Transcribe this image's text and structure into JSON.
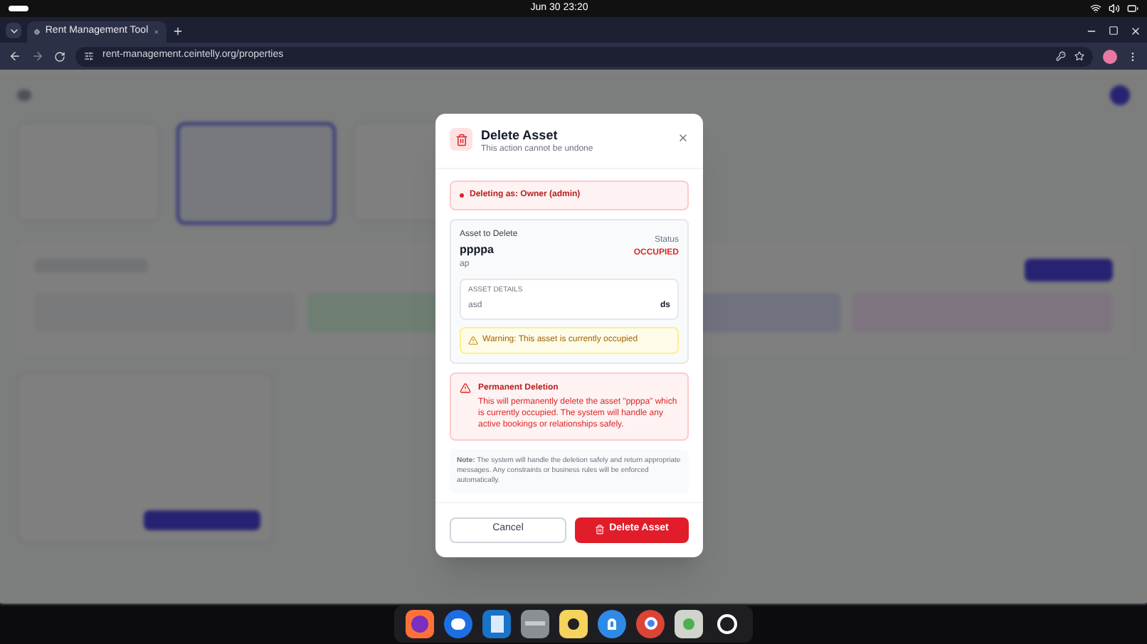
{
  "system_bar": {
    "clock": "Jun 30  23:20"
  },
  "browser": {
    "tabs": [
      {
        "title": "Rent Management Tool",
        "selected": true
      }
    ],
    "url": "rent-management.ceintelly.org/properties"
  },
  "dialog": {
    "title": "Delete Asset",
    "subtitle": "This action cannot be undone",
    "role_notice": "Deleting as: Owner (admin)",
    "asset": {
      "section_label": "Asset to Delete",
      "name": "ppppa",
      "type": "ap",
      "status_label": "Status",
      "status": "OCCUPIED",
      "details_heading": "ASSET DETAILS",
      "details": [
        {
          "key": "asd",
          "value": "ds"
        }
      ],
      "warning": "Warning: This asset is currently occupied"
    },
    "danger": {
      "title": "Permanent Deletion",
      "text": "This will permanently delete the asset \"ppppa\" which is currently occupied. The system will handle any active bookings or relationships safely."
    },
    "note": "**Note:** The system will handle the deletion safely and return appropriate messages. Any constraints or business rules will be enforced automatically.",
    "buttons": [
      {
        "label": "Cancel",
        "kind": "secondary"
      },
      {
        "label": "Delete Asset",
        "kind": "danger"
      }
    ]
  }
}
